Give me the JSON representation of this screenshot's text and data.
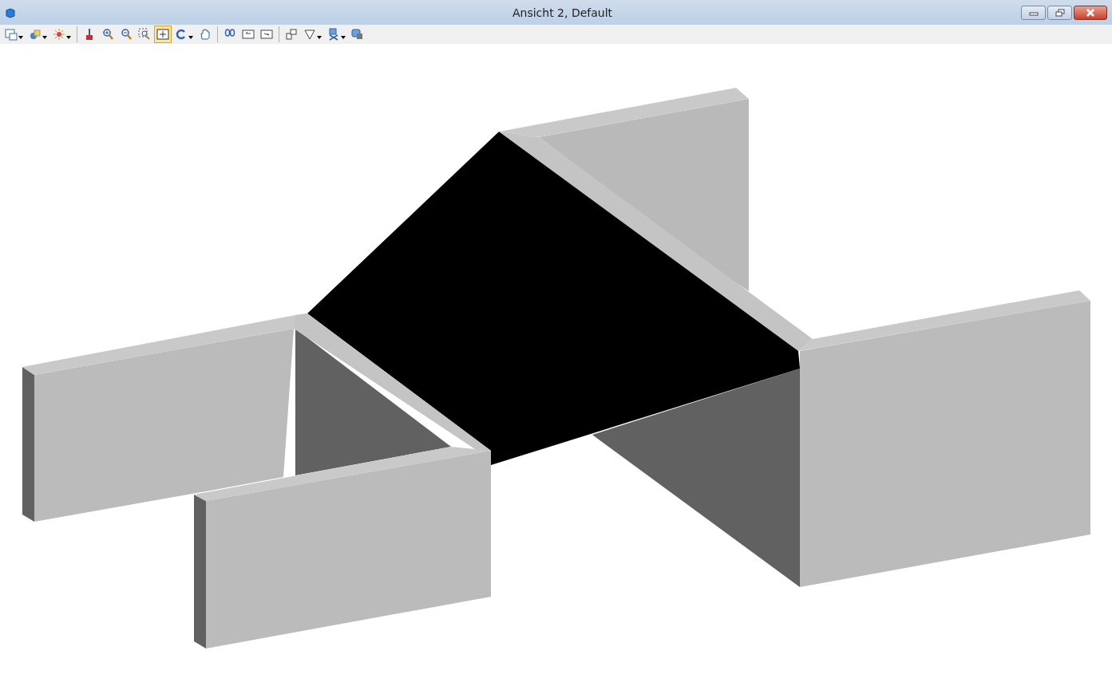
{
  "window": {
    "title": "Ansicht 2, Default"
  },
  "toolbar": {
    "groups": [
      [
        {
          "selected": false,
          "dropdown": true
        },
        {
          "selected": false,
          "dropdown": true
        },
        {
          "selected": false,
          "dropdown": true
        }
      ],
      [
        {
          "selected": false,
          "dropdown": false
        },
        {
          "selected": false,
          "dropdown": false
        },
        {
          "selected": false,
          "dropdown": false
        },
        {
          "selected": false,
          "dropdown": false
        },
        {
          "selected": true,
          "dropdown": false
        },
        {
          "selected": false,
          "dropdown": true
        },
        {
          "selected": false,
          "dropdown": false
        }
      ],
      [
        {
          "selected": false,
          "dropdown": false
        },
        {
          "selected": false,
          "dropdown": false
        },
        {
          "selected": false,
          "dropdown": false
        }
      ],
      [
        {
          "selected": false,
          "dropdown": false
        },
        {
          "selected": false,
          "dropdown": true
        },
        {
          "selected": false,
          "dropdown": true
        },
        {
          "selected": false,
          "dropdown": false
        }
      ]
    ]
  }
}
